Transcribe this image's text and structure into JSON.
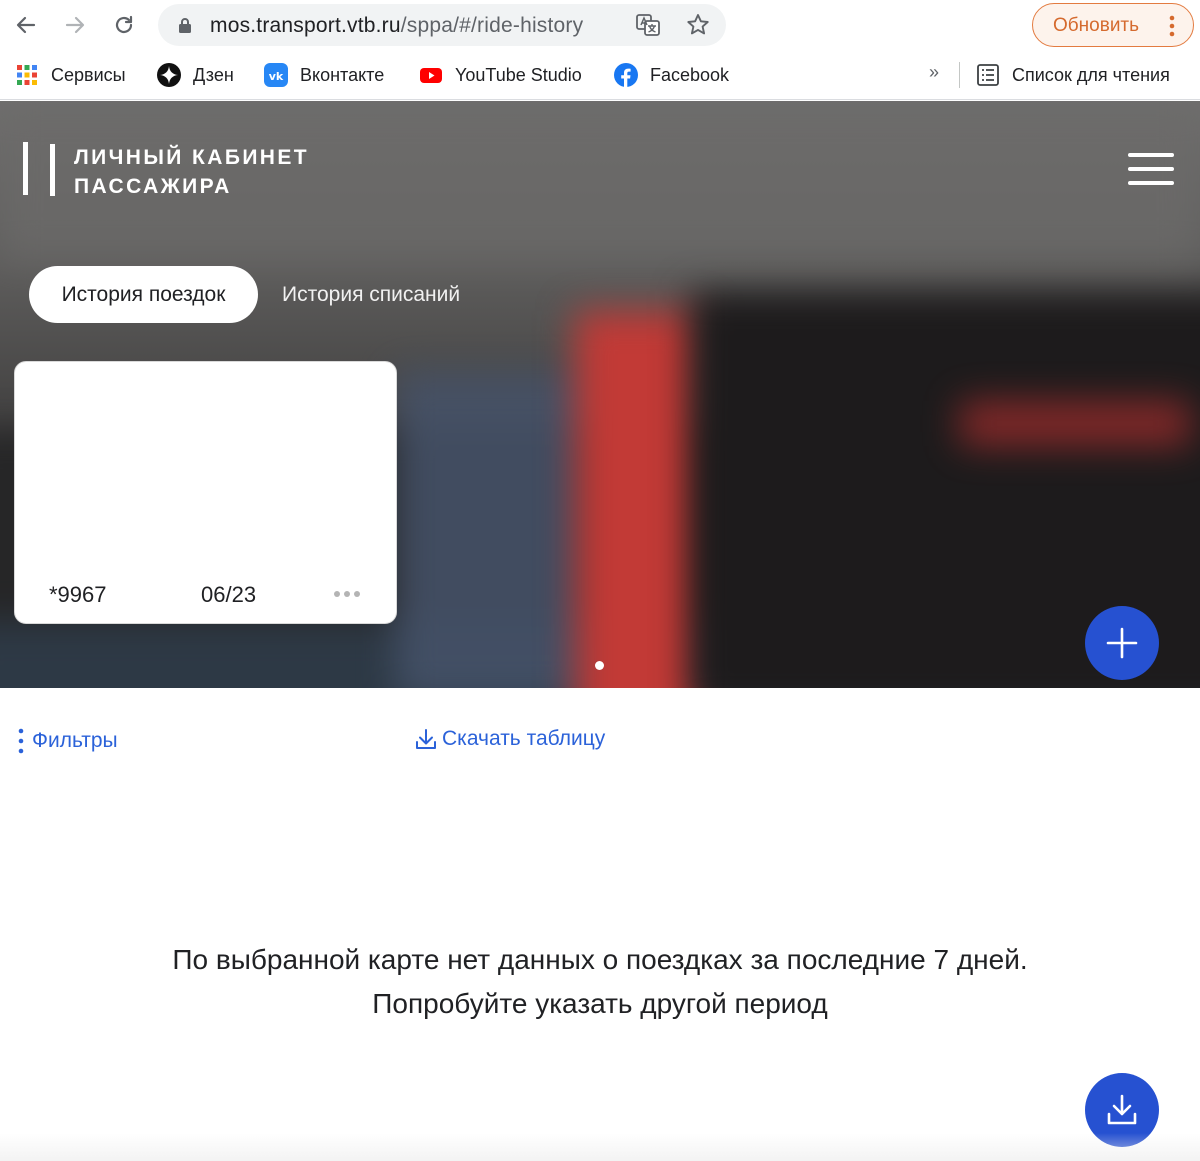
{
  "browser": {
    "url_host": "mos.transport.vtb.ru",
    "url_path": "/sppa/#/ride-history",
    "update_label": "Обновить",
    "bookmarks": [
      {
        "label": "Сервисы",
        "icon": "apps-grid-icon"
      },
      {
        "label": "Дзен",
        "icon": "dzen-icon"
      },
      {
        "label": "Вконтакте",
        "icon": "vk-icon"
      },
      {
        "label": "YouTube Studio",
        "icon": "youtube-icon"
      },
      {
        "label": "Facebook",
        "icon": "facebook-icon"
      }
    ],
    "more_label": "»",
    "reading_list_label": "Список для чтения"
  },
  "header": {
    "logo_line1": "ЛИЧНЫЙ КАБИНЕТ",
    "logo_line2": "ПАССАЖИРА"
  },
  "tabs": {
    "active": "История поездок",
    "inactive": "История списаний"
  },
  "card": {
    "number": "*9967",
    "expiry": "06/23"
  },
  "actions": {
    "filters": "Фильтры",
    "download": "Скачать таблицу"
  },
  "empty_state": {
    "line1": "По выбранной карте нет данных о поездках за последние 7 дней.",
    "line2": "Попробуйте указать другой период"
  },
  "colors": {
    "accent": "#2651d1",
    "link": "#2b62d9",
    "update_orange": "#d56a2e"
  }
}
